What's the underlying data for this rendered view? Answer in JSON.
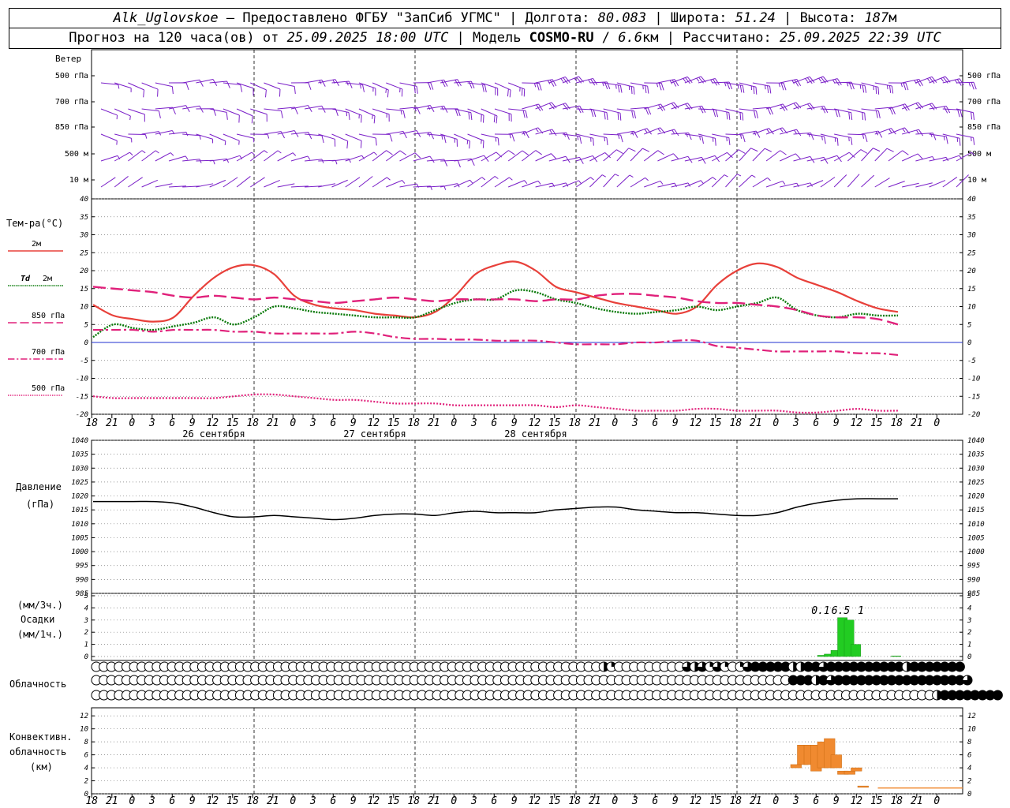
{
  "header": {
    "station": "Alk_Uglovskoe",
    "provider": " – Предоставлено ФГБУ \"ЗапСиб УГМС\" | Долгота: ",
    "lon": "80.083",
    "lat_label": " | Широта: ",
    "lat": "51.24",
    "alt_label": " | Высота: ",
    "alt": "187",
    "alt_unit": "м",
    "line2_a": "Прогноз на 120 часа(ов) от ",
    "run_time": "25.09.2025 18:00 UTC",
    "line2_b": " | Модель ",
    "model": "COSMO-RU",
    "line2_c": " / ",
    "resolution": "6.6",
    "res_unit": "км",
    "line2_d": " | Рассчитано: ",
    "calc_time": "25.09.2025 22:39 UTC"
  },
  "colors": {
    "t2m": "#e8403a",
    "td2m": "#0a7a0a",
    "t850": "#e0207a",
    "t700": "#e0207a",
    "t500": "#e0207a",
    "zero": "#2030d0",
    "wind": "#7a1fc8",
    "precip": "#22cc22",
    "conv": "#f08a30",
    "pressure": "#000000"
  },
  "chart_data": [
    {
      "type": "line",
      "title": "",
      "ylabel": "Тем-ра(°C)",
      "ylim": [
        -20,
        40
      ],
      "yticks": [
        40,
        35,
        30,
        25,
        20,
        15,
        10,
        5,
        0,
        -5,
        -10,
        -15,
        -20
      ],
      "x_hours": [
        0,
        3,
        6,
        9,
        12,
        15,
        18,
        21,
        24,
        27,
        30,
        33,
        36,
        39,
        42,
        45,
        48,
        51,
        54,
        57,
        60,
        63,
        66,
        69,
        72,
        75,
        78,
        81,
        84,
        87,
        90,
        93,
        96,
        99,
        102,
        105,
        108,
        111,
        114,
        117,
        120
      ],
      "x_tick_labels": [
        "18",
        "21",
        "0",
        "3",
        "6",
        "9",
        "12",
        "15",
        "18",
        "21",
        "0",
        "3",
        "6",
        "9",
        "12",
        "15",
        "18",
        "21",
        "0",
        "3",
        "6",
        "9",
        "12",
        "15",
        "18",
        "21",
        "0",
        "3",
        "6",
        "9",
        "12",
        "15",
        "18",
        "21",
        "0",
        "3",
        "6",
        "9",
        "12",
        "15",
        "18",
        "21",
        "0"
      ],
      "day_labels": [
        {
          "hour": 18,
          "text": "26 сентября"
        },
        {
          "hour": 42,
          "text": "27 сентября"
        },
        {
          "hour": 66,
          "text": "28 сентября"
        }
      ],
      "series": [
        {
          "name": "2м",
          "style": "solid",
          "values": [
            10.5,
            7.5,
            6.5,
            5.8,
            7,
            13,
            18,
            21,
            21.5,
            19,
            13,
            10.5,
            9.5,
            9,
            8,
            7.5,
            7,
            8.5,
            13,
            19,
            21.5,
            22.5,
            20,
            15.5,
            14,
            12.5,
            11,
            10,
            9,
            8,
            10,
            16,
            20,
            22,
            21,
            18,
            16,
            14,
            11.5,
            9.5,
            8.5
          ]
        },
        {
          "name": "Td 2м",
          "style": "dotted",
          "values": [
            1.5,
            5,
            4,
            3.5,
            4.5,
            5.5,
            7,
            5,
            7,
            10,
            9.5,
            8.5,
            8,
            7.5,
            7,
            7,
            7,
            9,
            11,
            12,
            12,
            14.5,
            14,
            12,
            11,
            9.5,
            8.5,
            8,
            8.5,
            9,
            10,
            9,
            10,
            11,
            12.5,
            9,
            7.5,
            7,
            8,
            7.5,
            7.5
          ]
        },
        {
          "name": "850 гПа",
          "style": "longdash",
          "values": [
            15.5,
            15,
            14.5,
            14,
            13,
            12.5,
            13,
            12.5,
            12,
            12.5,
            12,
            11.5,
            11,
            11.5,
            12,
            12.5,
            12,
            11.5,
            12,
            12,
            12,
            12,
            11.5,
            12,
            12,
            13,
            13.5,
            13.5,
            13,
            12.5,
            11.5,
            11,
            11,
            10.5,
            10,
            9,
            7.5,
            7,
            7,
            6.5,
            5
          ]
        },
        {
          "name": "700 гПа",
          "style": "dashdot",
          "values": [
            3.5,
            3.5,
            3.5,
            3,
            3.5,
            3.5,
            3.5,
            3,
            3,
            2.5,
            2.5,
            2.5,
            2.5,
            3,
            2.5,
            1.5,
            1,
            1,
            0.8,
            0.8,
            0.5,
            0.5,
            0.5,
            0,
            -0.5,
            -0.5,
            -0.5,
            0,
            0,
            0.5,
            0.5,
            -1,
            -1.5,
            -2,
            -2.5,
            -2.5,
            -2.5,
            -2.5,
            -3,
            -3,
            -3.5
          ]
        },
        {
          "name": "500 гПа",
          "style": "dense",
          "values": [
            -15,
            -15.5,
            -15.5,
            -15.5,
            -15.5,
            -15.5,
            -15.5,
            -15,
            -14.5,
            -14.5,
            -15,
            -15.5,
            -16,
            -16,
            -16.5,
            -17,
            -17,
            -17,
            -17.5,
            -17.5,
            -17.5,
            -17.5,
            -17.5,
            -18,
            -17.5,
            -18,
            -18.5,
            -19,
            -19,
            -19,
            -18.5,
            -18.5,
            -19,
            -19,
            -19,
            -19.5,
            -19.5,
            -19,
            -18.5,
            -19,
            -19
          ]
        }
      ]
    },
    {
      "type": "line",
      "title": "",
      "ylabel": "Давление",
      "yunit": "(гПа)",
      "ylim": [
        985,
        1040
      ],
      "yticks": [
        1040,
        1035,
        1030,
        1025,
        1020,
        1015,
        1010,
        1005,
        1000,
        995,
        990,
        985
      ],
      "series": [
        {
          "name": "",
          "values": [
            1018,
            1018,
            1018,
            1018,
            1017.5,
            1016,
            1014,
            1012.5,
            1012.5,
            1013,
            1012.5,
            1012,
            1011.5,
            1012,
            1013,
            1013.5,
            1013.5,
            1013,
            1014,
            1014.5,
            1014,
            1014,
            1014,
            1015,
            1015.5,
            1016,
            1016,
            1015,
            1014.5,
            1014,
            1014,
            1013.5,
            1013,
            1013,
            1014,
            1016,
            1017.5,
            1018.5,
            1019,
            1019,
            1019
          ]
        }
      ]
    },
    {
      "type": "bar",
      "title": "",
      "ylabel": "Осадки",
      "units_top": "(мм/3ч.)",
      "units_bottom": "(мм/1ч.)",
      "ylim": [
        0,
        5
      ],
      "yticks": [
        5,
        4,
        3,
        2,
        1,
        0
      ],
      "bars": [
        {
          "hour": 108,
          "value": 0.1
        },
        {
          "hour": 109,
          "value": 0.2
        },
        {
          "hour": 110,
          "value": 0.5
        },
        {
          "hour": 111,
          "value": 3.2
        },
        {
          "hour": 112,
          "value": 3.0
        },
        {
          "hour": 113,
          "value": 1.0
        },
        {
          "hour": 119,
          "value": 0.05
        }
      ],
      "totals": [
        {
          "hour": 108,
          "text": "0.1"
        },
        {
          "hour": 111,
          "text": "6.5"
        },
        {
          "hour": 114,
          "text": "1"
        }
      ]
    },
    {
      "type": "table",
      "title": "",
      "ylabel": "Облачность",
      "levels": [
        "upper",
        "middle",
        "lower"
      ],
      "cover": {
        "upper": [
          0,
          0,
          0,
          0,
          0,
          0,
          0,
          0,
          0,
          0,
          0,
          0,
          0,
          0,
          0,
          0,
          0,
          0,
          0,
          0,
          0,
          0,
          0,
          0,
          0,
          0,
          0,
          0,
          0,
          0,
          0,
          0,
          0,
          0,
          0,
          0,
          0,
          0,
          0,
          0,
          0,
          0,
          0,
          0,
          0,
          0,
          0,
          0,
          0,
          0,
          0,
          0,
          0,
          0,
          0,
          0,
          0,
          0,
          0,
          0,
          0,
          0,
          0,
          0,
          0,
          0,
          0,
          0.5,
          0.25,
          0,
          0,
          0,
          0,
          0,
          0,
          0,
          0,
          0,
          0.75,
          0.5,
          0.75,
          0.25,
          0.75,
          0.25,
          0,
          0.25,
          0.75,
          1,
          1,
          1,
          1,
          1,
          0.5,
          0.5,
          1,
          1,
          0.75,
          1,
          1,
          1,
          1,
          1,
          1,
          1,
          1,
          1,
          1,
          0.5,
          1,
          1,
          1,
          1,
          1,
          1,
          1
        ],
        "middle": [
          0,
          0,
          0,
          0,
          0,
          0,
          0,
          0,
          0,
          0,
          0,
          0,
          0,
          0,
          0,
          0,
          0,
          0,
          0,
          0,
          0,
          0,
          0,
          0,
          0,
          0,
          0,
          0,
          0,
          0,
          0,
          0,
          0,
          0,
          0,
          0,
          0,
          0,
          0,
          0,
          0,
          0,
          0,
          0,
          0,
          0,
          0,
          0,
          0,
          0,
          0,
          0,
          0,
          0,
          0,
          0,
          0,
          0,
          0,
          0,
          0,
          0,
          0,
          0,
          0,
          0,
          0,
          0,
          0,
          0,
          0,
          0,
          0,
          0,
          0,
          0,
          0,
          0,
          0,
          0,
          0,
          0,
          0,
          0,
          0,
          0,
          0,
          0,
          0,
          0,
          0,
          0,
          1,
          1,
          1,
          0.5,
          1,
          0.75,
          1,
          1,
          1,
          1,
          1,
          1,
          1,
          1,
          1,
          1,
          1,
          1,
          1,
          1,
          1,
          1,
          1,
          0.75
        ],
        "lower": [
          0,
          0,
          0,
          0,
          0,
          0,
          0,
          0,
          0,
          0,
          0,
          0,
          0,
          0,
          0,
          0,
          0,
          0,
          0,
          0,
          0,
          0,
          0,
          0,
          0,
          0,
          0,
          0,
          0,
          0,
          0,
          0,
          0,
          0,
          0,
          0,
          0,
          0,
          0,
          0,
          0,
          0,
          0,
          0,
          0,
          0,
          0,
          0,
          0,
          0,
          0,
          0,
          0,
          0,
          0,
          0,
          0,
          0,
          0,
          0,
          0,
          0,
          0,
          0,
          0,
          0,
          0,
          0,
          0,
          0,
          0,
          0,
          0,
          0,
          0,
          0,
          0,
          0,
          0,
          0,
          0,
          0,
          0,
          0,
          0,
          0,
          0,
          0,
          0,
          0,
          0,
          0,
          0,
          0,
          0,
          0,
          0,
          0,
          0,
          0,
          0,
          0,
          0,
          0,
          0,
          0,
          0,
          0,
          0,
          0,
          0,
          0.5,
          1,
          1,
          1,
          1,
          1,
          1,
          1,
          1
        ]
      }
    },
    {
      "type": "bar",
      "title": "",
      "ylabel": "Конвективн. облачность",
      "yunit": "(км)",
      "ylim": [
        0,
        13
      ],
      "yticks": [
        12,
        10,
        8,
        6,
        4,
        2,
        0
      ],
      "bars": [
        {
          "hour": 104,
          "base": 4,
          "top": 4.5
        },
        {
          "hour": 105,
          "base": 4.5,
          "top": 7.5
        },
        {
          "hour": 106,
          "base": 4.5,
          "top": 7.5
        },
        {
          "hour": 107,
          "base": 3.5,
          "top": 7.5
        },
        {
          "hour": 108,
          "base": 4,
          "top": 8
        },
        {
          "hour": 109,
          "base": 4,
          "top": 8.5
        },
        {
          "hour": 110,
          "base": 4,
          "top": 6
        },
        {
          "hour": 111,
          "base": 3,
          "top": 3.5
        },
        {
          "hour": 112,
          "base": 3,
          "top": 3.5
        },
        {
          "hour": 113,
          "base": 3.5,
          "top": 4
        },
        {
          "hour": 114,
          "base": 1,
          "top": 1.2
        }
      ]
    },
    {
      "type": "wind",
      "title": "Ветер",
      "levels": [
        "500 гПа",
        "700 гПа",
        "850 гПа",
        "500 м",
        "10 м"
      ],
      "speeds": {
        "500 гПа": [
          9,
          11,
          15,
          21,
          26,
          28,
          28,
          27,
          26
        ],
        "700 гПа": [
          9,
          11,
          14,
          19,
          23,
          24,
          24,
          23,
          22
        ],
        "850 гПа": [
          6,
          8,
          11,
          15,
          18,
          19,
          18,
          18,
          17
        ],
        "500 м": [
          5,
          6,
          8,
          11,
          12,
          12,
          11,
          10,
          9
        ],
        "10 м": [
          2,
          3,
          4,
          5,
          6,
          6,
          5,
          4,
          4
        ]
      }
    }
  ]
}
